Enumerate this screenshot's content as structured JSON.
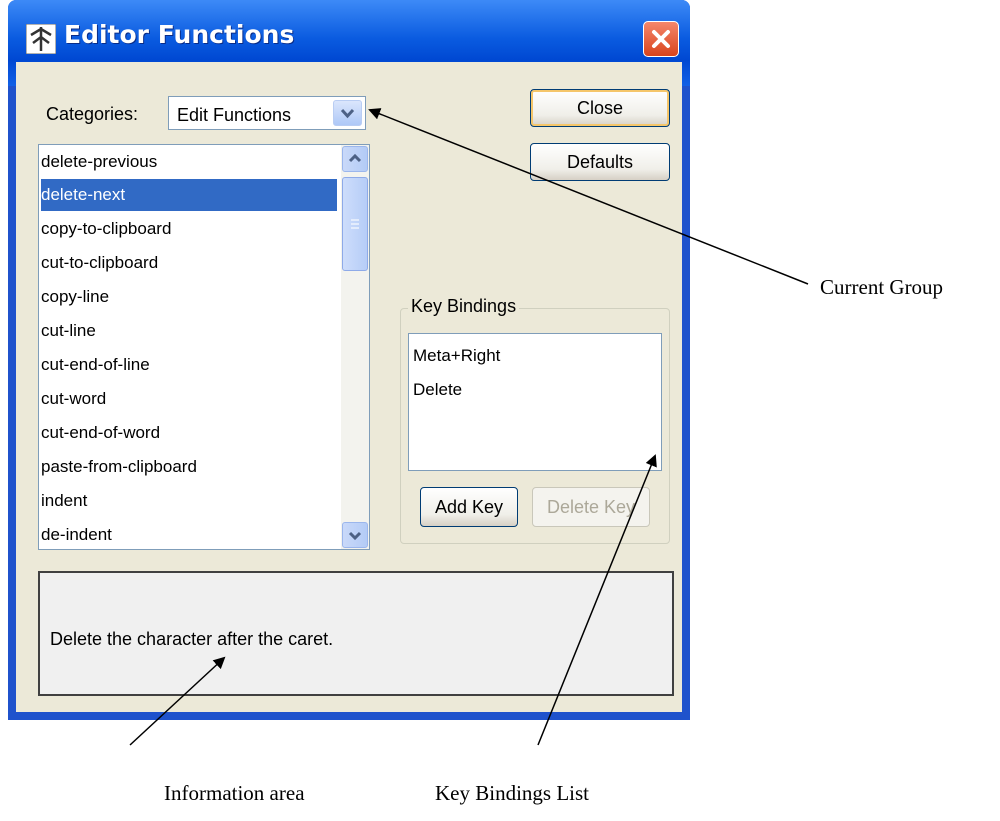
{
  "window": {
    "title": "Editor Functions"
  },
  "categories": {
    "label": "Categories:",
    "selected": "Edit Functions"
  },
  "buttons": {
    "close": "Close",
    "defaults": "Defaults",
    "add_key": "Add Key",
    "delete_key": "Delete Key"
  },
  "functions": {
    "items": [
      "delete-previous",
      "delete-next",
      "copy-to-clipboard",
      "cut-to-clipboard",
      "copy-line",
      "cut-line",
      "cut-end-of-line",
      "cut-word",
      "cut-end-of-word",
      "paste-from-clipboard",
      "indent",
      "de-indent"
    ],
    "selected": "delete-next"
  },
  "key_bindings": {
    "title": "Key Bindings",
    "items": [
      "Meta+Right",
      "Delete"
    ]
  },
  "info": {
    "text": "Delete the character after the caret."
  },
  "annotations": {
    "current_group": "Current Group",
    "information_area": "Information area",
    "key_bindings_list": "Key Bindings List"
  },
  "colors": {
    "title_bar": "#0a5be0",
    "selection": "#316ac5",
    "dialog_bg": "#ece9d8",
    "close_button": "#e0552f"
  }
}
